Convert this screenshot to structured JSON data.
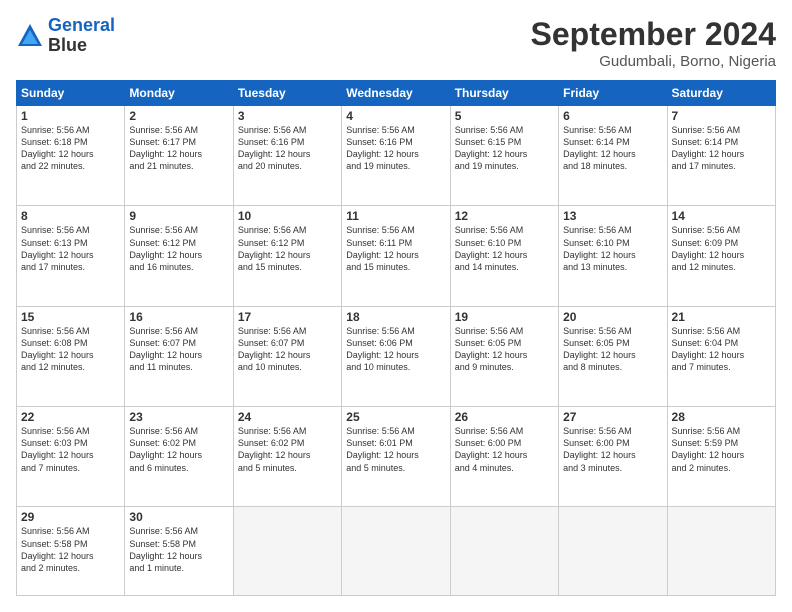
{
  "logo": {
    "line1": "General",
    "line2": "Blue"
  },
  "header": {
    "month": "September 2024",
    "location": "Gudumbali, Borno, Nigeria"
  },
  "weekdays": [
    "Sunday",
    "Monday",
    "Tuesday",
    "Wednesday",
    "Thursday",
    "Friday",
    "Saturday"
  ],
  "weeks": [
    [
      {
        "day": "1",
        "info": "Sunrise: 5:56 AM\nSunset: 6:18 PM\nDaylight: 12 hours\nand 22 minutes."
      },
      {
        "day": "2",
        "info": "Sunrise: 5:56 AM\nSunset: 6:17 PM\nDaylight: 12 hours\nand 21 minutes."
      },
      {
        "day": "3",
        "info": "Sunrise: 5:56 AM\nSunset: 6:16 PM\nDaylight: 12 hours\nand 20 minutes."
      },
      {
        "day": "4",
        "info": "Sunrise: 5:56 AM\nSunset: 6:16 PM\nDaylight: 12 hours\nand 19 minutes."
      },
      {
        "day": "5",
        "info": "Sunrise: 5:56 AM\nSunset: 6:15 PM\nDaylight: 12 hours\nand 19 minutes."
      },
      {
        "day": "6",
        "info": "Sunrise: 5:56 AM\nSunset: 6:14 PM\nDaylight: 12 hours\nand 18 minutes."
      },
      {
        "day": "7",
        "info": "Sunrise: 5:56 AM\nSunset: 6:14 PM\nDaylight: 12 hours\nand 17 minutes."
      }
    ],
    [
      {
        "day": "8",
        "info": "Sunrise: 5:56 AM\nSunset: 6:13 PM\nDaylight: 12 hours\nand 17 minutes."
      },
      {
        "day": "9",
        "info": "Sunrise: 5:56 AM\nSunset: 6:12 PM\nDaylight: 12 hours\nand 16 minutes."
      },
      {
        "day": "10",
        "info": "Sunrise: 5:56 AM\nSunset: 6:12 PM\nDaylight: 12 hours\nand 15 minutes."
      },
      {
        "day": "11",
        "info": "Sunrise: 5:56 AM\nSunset: 6:11 PM\nDaylight: 12 hours\nand 15 minutes."
      },
      {
        "day": "12",
        "info": "Sunrise: 5:56 AM\nSunset: 6:10 PM\nDaylight: 12 hours\nand 14 minutes."
      },
      {
        "day": "13",
        "info": "Sunrise: 5:56 AM\nSunset: 6:10 PM\nDaylight: 12 hours\nand 13 minutes."
      },
      {
        "day": "14",
        "info": "Sunrise: 5:56 AM\nSunset: 6:09 PM\nDaylight: 12 hours\nand 12 minutes."
      }
    ],
    [
      {
        "day": "15",
        "info": "Sunrise: 5:56 AM\nSunset: 6:08 PM\nDaylight: 12 hours\nand 12 minutes."
      },
      {
        "day": "16",
        "info": "Sunrise: 5:56 AM\nSunset: 6:07 PM\nDaylight: 12 hours\nand 11 minutes."
      },
      {
        "day": "17",
        "info": "Sunrise: 5:56 AM\nSunset: 6:07 PM\nDaylight: 12 hours\nand 10 minutes."
      },
      {
        "day": "18",
        "info": "Sunrise: 5:56 AM\nSunset: 6:06 PM\nDaylight: 12 hours\nand 10 minutes."
      },
      {
        "day": "19",
        "info": "Sunrise: 5:56 AM\nSunset: 6:05 PM\nDaylight: 12 hours\nand 9 minutes."
      },
      {
        "day": "20",
        "info": "Sunrise: 5:56 AM\nSunset: 6:05 PM\nDaylight: 12 hours\nand 8 minutes."
      },
      {
        "day": "21",
        "info": "Sunrise: 5:56 AM\nSunset: 6:04 PM\nDaylight: 12 hours\nand 7 minutes."
      }
    ],
    [
      {
        "day": "22",
        "info": "Sunrise: 5:56 AM\nSunset: 6:03 PM\nDaylight: 12 hours\nand 7 minutes."
      },
      {
        "day": "23",
        "info": "Sunrise: 5:56 AM\nSunset: 6:02 PM\nDaylight: 12 hours\nand 6 minutes."
      },
      {
        "day": "24",
        "info": "Sunrise: 5:56 AM\nSunset: 6:02 PM\nDaylight: 12 hours\nand 5 minutes."
      },
      {
        "day": "25",
        "info": "Sunrise: 5:56 AM\nSunset: 6:01 PM\nDaylight: 12 hours\nand 5 minutes."
      },
      {
        "day": "26",
        "info": "Sunrise: 5:56 AM\nSunset: 6:00 PM\nDaylight: 12 hours\nand 4 minutes."
      },
      {
        "day": "27",
        "info": "Sunrise: 5:56 AM\nSunset: 6:00 PM\nDaylight: 12 hours\nand 3 minutes."
      },
      {
        "day": "28",
        "info": "Sunrise: 5:56 AM\nSunset: 5:59 PM\nDaylight: 12 hours\nand 2 minutes."
      }
    ],
    [
      {
        "day": "29",
        "info": "Sunrise: 5:56 AM\nSunset: 5:58 PM\nDaylight: 12 hours\nand 2 minutes."
      },
      {
        "day": "30",
        "info": "Sunrise: 5:56 AM\nSunset: 5:58 PM\nDaylight: 12 hours\nand 1 minute."
      },
      {
        "day": "",
        "info": ""
      },
      {
        "day": "",
        "info": ""
      },
      {
        "day": "",
        "info": ""
      },
      {
        "day": "",
        "info": ""
      },
      {
        "day": "",
        "info": ""
      }
    ]
  ]
}
